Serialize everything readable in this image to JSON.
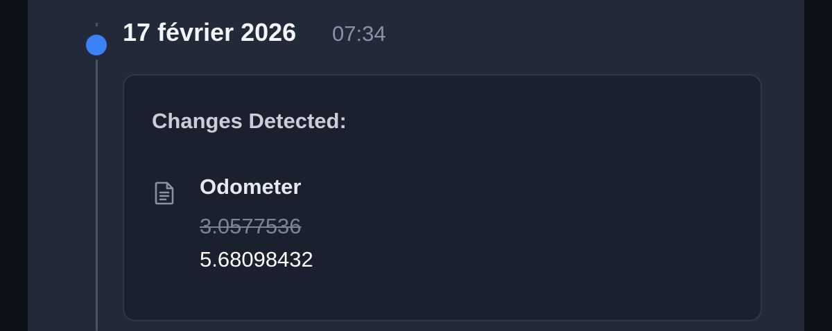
{
  "entry": {
    "date": "17 février 2026",
    "time": "07:34"
  },
  "card": {
    "heading": "Changes Detected:",
    "change": {
      "icon": "document-icon",
      "field": "Odometer",
      "old_value": "3.0577536",
      "new_value": "5.68098432"
    }
  },
  "colors": {
    "accent": "#3b82f6",
    "panel": "#222938",
    "card": "#1a202d"
  }
}
